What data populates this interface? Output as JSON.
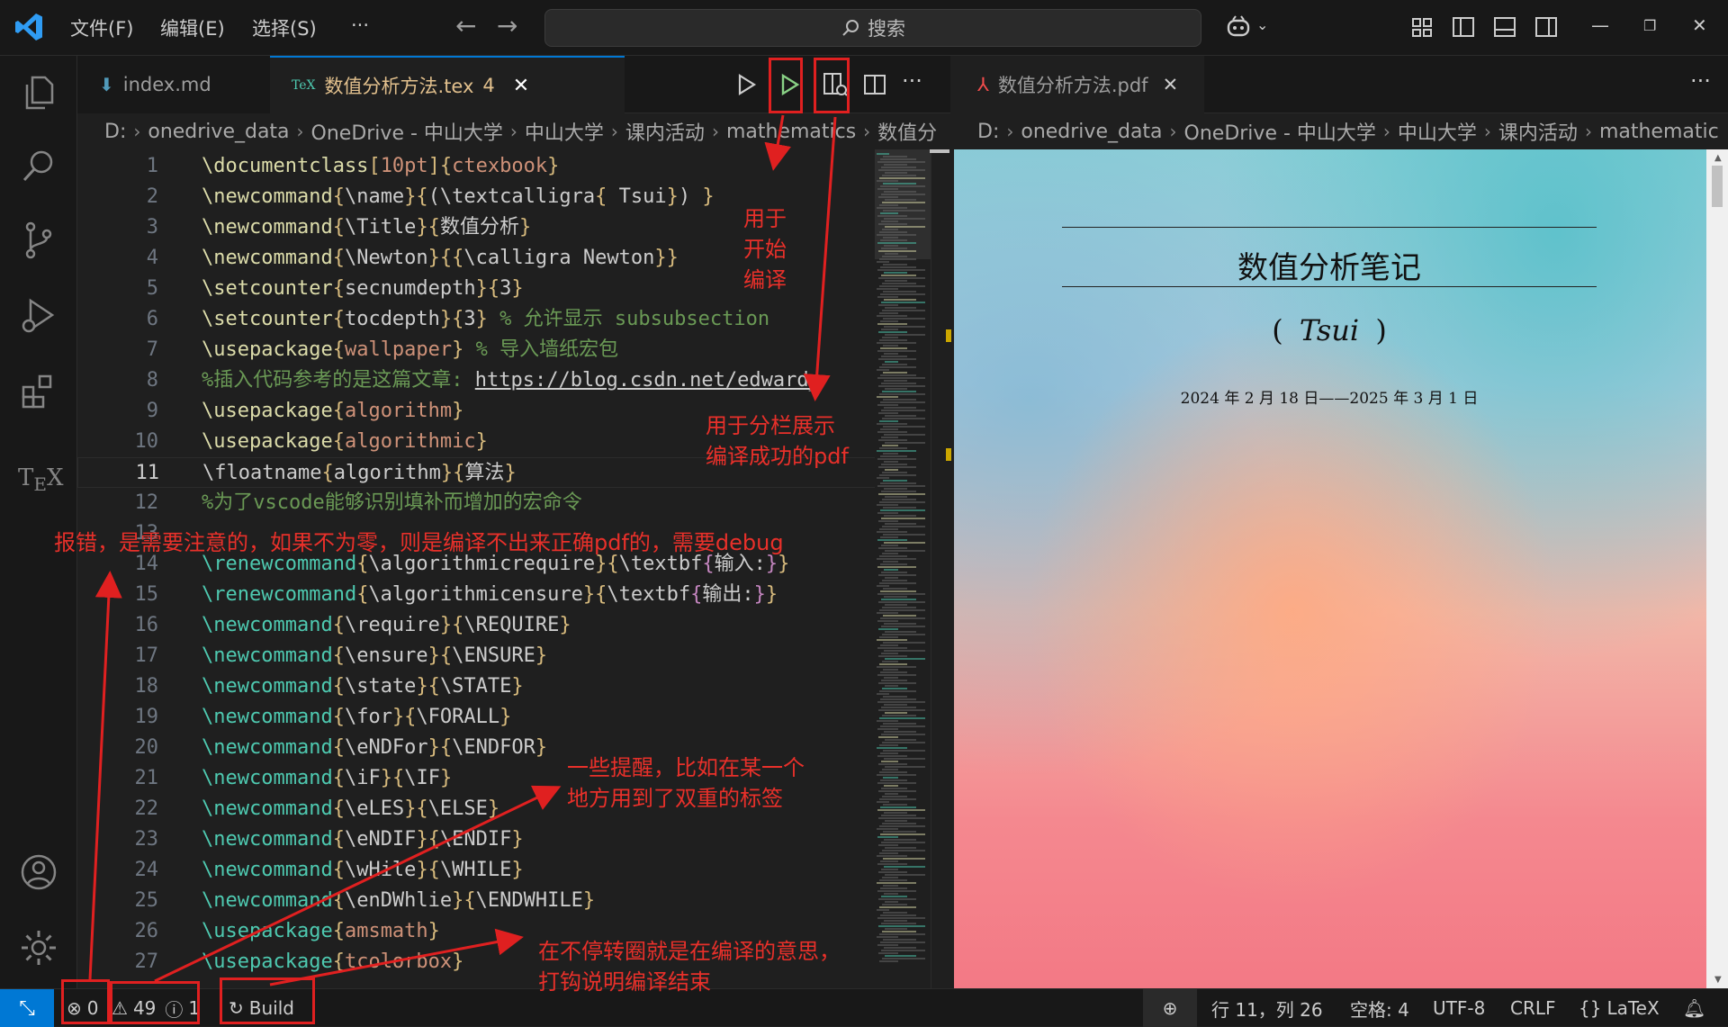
{
  "titlebar": {
    "menu": [
      "文件(F)",
      "编辑(E)",
      "选择(S)",
      "···"
    ],
    "search_placeholder": "搜索"
  },
  "tabs": [
    {
      "label": "index.md",
      "active": false
    },
    {
      "label": "数值分析方法.tex",
      "badge": "4",
      "active": true
    }
  ],
  "pdf_tab": {
    "label": "数值分析方法.pdf"
  },
  "breadcrumb_editor": [
    "D:",
    "onedrive_data",
    "OneDrive - 中山大学",
    "中山大学",
    "课内活动",
    "mathematics",
    "数值分"
  ],
  "breadcrumb_pdf": [
    "D:",
    "onedrive_data",
    "OneDrive - 中山大学",
    "中山大学",
    "课内活动",
    "mathematic"
  ],
  "editor": {
    "current_line": 11,
    "lines": [
      {
        "n": "1",
        "segs": [
          [
            "kw",
            "\\documentclass"
          ],
          [
            "br",
            "["
          ],
          [
            "arg",
            "10pt"
          ],
          [
            "br",
            "]{"
          ],
          [
            "arg",
            "ctexbook"
          ],
          [
            "br",
            "}"
          ]
        ]
      },
      {
        "n": "2",
        "segs": [
          [
            "kw",
            "\\newcommand"
          ],
          [
            "br",
            "{"
          ],
          [
            "txt",
            "\\name"
          ],
          [
            "br",
            "}{"
          ],
          [
            "txt",
            "(\\textcalligra"
          ],
          [
            "br",
            "{"
          ],
          [
            "txt",
            " Tsui"
          ],
          [
            "br",
            "}"
          ],
          [
            "txt",
            ") "
          ],
          [
            "br",
            "}"
          ]
        ]
      },
      {
        "n": "3",
        "segs": [
          [
            "kw",
            "\\newcommand"
          ],
          [
            "br",
            "{"
          ],
          [
            "txt",
            "\\Title"
          ],
          [
            "br",
            "}{"
          ],
          [
            "txt",
            "数值分析"
          ],
          [
            "br",
            "}"
          ]
        ]
      },
      {
        "n": "4",
        "segs": [
          [
            "kw",
            "\\newcommand"
          ],
          [
            "br",
            "{"
          ],
          [
            "txt",
            "\\Newton"
          ],
          [
            "br",
            "}{{"
          ],
          [
            "txt",
            "\\calligra Newton"
          ],
          [
            "br",
            "}}"
          ]
        ]
      },
      {
        "n": "5",
        "segs": [
          [
            "kw",
            "\\setcounter"
          ],
          [
            "br",
            "{"
          ],
          [
            "txt",
            "secnumdepth"
          ],
          [
            "br",
            "}{"
          ],
          [
            "txt",
            "3"
          ],
          [
            "br",
            "}"
          ]
        ]
      },
      {
        "n": "6",
        "segs": [
          [
            "kw",
            "\\setcounter"
          ],
          [
            "br",
            "{"
          ],
          [
            "txt",
            "tocdepth"
          ],
          [
            "br",
            "}{"
          ],
          [
            "txt",
            "3"
          ],
          [
            "br",
            "}"
          ],
          [
            "cm",
            " % 允许显示 subsubsection"
          ]
        ]
      },
      {
        "n": "7",
        "segs": [
          [
            "kw",
            "\\usepackage"
          ],
          [
            "br",
            "{"
          ],
          [
            "arg",
            "wallpaper"
          ],
          [
            "br",
            "}"
          ],
          [
            "cm",
            " % 导入墙纸宏包"
          ]
        ]
      },
      {
        "n": "8",
        "segs": [
          [
            "cm",
            "%插入代码参考的是这篇文章: "
          ],
          [
            "url",
            "https://blog.csdn.net/edward_"
          ]
        ]
      },
      {
        "n": "9",
        "segs": [
          [
            "kw",
            "\\usepackage"
          ],
          [
            "br",
            "{"
          ],
          [
            "arg",
            "algorithm"
          ],
          [
            "br",
            "}"
          ]
        ]
      },
      {
        "n": "10",
        "segs": [
          [
            "kw",
            "\\usepackage"
          ],
          [
            "br",
            "{"
          ],
          [
            "arg",
            "algorithmic"
          ],
          [
            "br",
            "}"
          ]
        ]
      },
      {
        "n": "11",
        "segs": [
          [
            "txt",
            "\\floatname"
          ],
          [
            "br",
            "{"
          ],
          [
            "txt",
            "algorithm"
          ],
          [
            "br",
            "}{"
          ],
          [
            "txt",
            "算法"
          ],
          [
            "br",
            "}"
          ]
        ]
      },
      {
        "n": "12",
        "segs": [
          [
            "cm",
            "%为了vscode能够识别填补而增加的宏命令"
          ]
        ]
      },
      {
        "n": "13",
        "segs": []
      },
      {
        "n": "14",
        "segs": [
          [
            "fn",
            "\\renewcommand"
          ],
          [
            "br",
            "{"
          ],
          [
            "txt",
            "\\algorithmicrequire"
          ],
          [
            "br",
            "}{"
          ],
          [
            "txt",
            "\\textbf"
          ],
          [
            "ar",
            "{"
          ],
          [
            "txt",
            "输入:"
          ],
          [
            "ar",
            "}"
          ],
          [
            "br",
            "}"
          ]
        ]
      },
      {
        "n": "15",
        "segs": [
          [
            "fn",
            "\\renewcommand"
          ],
          [
            "br",
            "{"
          ],
          [
            "txt",
            "\\algorithmicensure"
          ],
          [
            "br",
            "}{"
          ],
          [
            "txt",
            "\\textbf"
          ],
          [
            "ar",
            "{"
          ],
          [
            "txt",
            "输出:"
          ],
          [
            "ar",
            "}"
          ],
          [
            "br",
            "}"
          ]
        ]
      },
      {
        "n": "16",
        "segs": [
          [
            "fn",
            "\\newcommand"
          ],
          [
            "br",
            "{"
          ],
          [
            "txt",
            "\\require"
          ],
          [
            "br",
            "}{"
          ],
          [
            "txt",
            "\\REQUIRE"
          ],
          [
            "br",
            "}"
          ]
        ]
      },
      {
        "n": "17",
        "segs": [
          [
            "fn",
            "\\newcommand"
          ],
          [
            "br",
            "{"
          ],
          [
            "txt",
            "\\ensure"
          ],
          [
            "br",
            "}{"
          ],
          [
            "txt",
            "\\ENSURE"
          ],
          [
            "br",
            "}"
          ]
        ]
      },
      {
        "n": "18",
        "segs": [
          [
            "fn",
            "\\newcommand"
          ],
          [
            "br",
            "{"
          ],
          [
            "txt",
            "\\state"
          ],
          [
            "br",
            "}{"
          ],
          [
            "txt",
            "\\STATE"
          ],
          [
            "br",
            "}"
          ]
        ]
      },
      {
        "n": "19",
        "segs": [
          [
            "fn",
            "\\newcommand"
          ],
          [
            "br",
            "{"
          ],
          [
            "txt",
            "\\for"
          ],
          [
            "br",
            "}{"
          ],
          [
            "txt",
            "\\FORALL"
          ],
          [
            "br",
            "}"
          ]
        ]
      },
      {
        "n": "20",
        "segs": [
          [
            "fn",
            "\\newcommand"
          ],
          [
            "br",
            "{"
          ],
          [
            "txt",
            "\\eNDFor"
          ],
          [
            "br",
            "}{"
          ],
          [
            "txt",
            "\\ENDFOR"
          ],
          [
            "br",
            "}"
          ]
        ]
      },
      {
        "n": "21",
        "segs": [
          [
            "fn",
            "\\newcommand"
          ],
          [
            "br",
            "{"
          ],
          [
            "txt",
            "\\iF"
          ],
          [
            "br",
            "}{"
          ],
          [
            "txt",
            "\\IF"
          ],
          [
            "br",
            "}"
          ]
        ]
      },
      {
        "n": "22",
        "segs": [
          [
            "fn",
            "\\newcommand"
          ],
          [
            "br",
            "{"
          ],
          [
            "txt",
            "\\eLES"
          ],
          [
            "br",
            "}{"
          ],
          [
            "txt",
            "\\ELSE"
          ],
          [
            "br",
            "}"
          ]
        ]
      },
      {
        "n": "23",
        "segs": [
          [
            "fn",
            "\\newcommand"
          ],
          [
            "br",
            "{"
          ],
          [
            "txt",
            "\\eNDIF"
          ],
          [
            "br",
            "}{"
          ],
          [
            "txt",
            "\\ENDIF"
          ],
          [
            "br",
            "}"
          ]
        ]
      },
      {
        "n": "24",
        "segs": [
          [
            "fn",
            "\\newcommand"
          ],
          [
            "br",
            "{"
          ],
          [
            "txt",
            "\\wHile"
          ],
          [
            "br",
            "}{"
          ],
          [
            "txt",
            "\\WHILE"
          ],
          [
            "br",
            "}"
          ]
        ]
      },
      {
        "n": "25",
        "segs": [
          [
            "fn",
            "\\newcommand"
          ],
          [
            "br",
            "{"
          ],
          [
            "txt",
            "\\enDWhlie"
          ],
          [
            "br",
            "}{"
          ],
          [
            "txt",
            "\\ENDWHILE"
          ],
          [
            "br",
            "}"
          ]
        ]
      },
      {
        "n": "26",
        "segs": [
          [
            "fn",
            "\\usepackage"
          ],
          [
            "br",
            "{"
          ],
          [
            "arg",
            "amsmath"
          ],
          [
            "br",
            "}"
          ]
        ]
      },
      {
        "n": "27",
        "segs": [
          [
            "fn",
            "\\usepackage"
          ],
          [
            "br",
            "{"
          ],
          [
            "arg",
            "tcolorbox"
          ],
          [
            "br",
            "}"
          ]
        ]
      }
    ]
  },
  "pdf": {
    "title": "数值分析笔记",
    "author_open": "(",
    "author_script": "Tsui",
    "author_close": ")",
    "date": "2024 年 2 月 18 日——2025 年 3 月 1 日"
  },
  "annotations": {
    "compile": "用于\n开始\n编译",
    "split": "用于分栏展示\n编译成功的pdf",
    "errors": "报错，是需要注意的，如果不为零，则是编译不出来正确pdf的，需要debug",
    "warnings": "一些提醒，比如在某一个\n地方用到了双重的标签",
    "building": "在不停转圈就是在编译的意思，\n打钩说明编译结束"
  },
  "statusbar": {
    "errors": "0",
    "warnings": "49",
    "info": "1",
    "build": "Build",
    "position": "行 11，列 26",
    "spaces": "空格: 4",
    "encoding": "UTF-8",
    "eol": "CRLF",
    "language": "LaTeX"
  },
  "colors": {
    "accent": "#0078d4",
    "annotation_red": "#e02020",
    "run_green": "#89d185"
  }
}
